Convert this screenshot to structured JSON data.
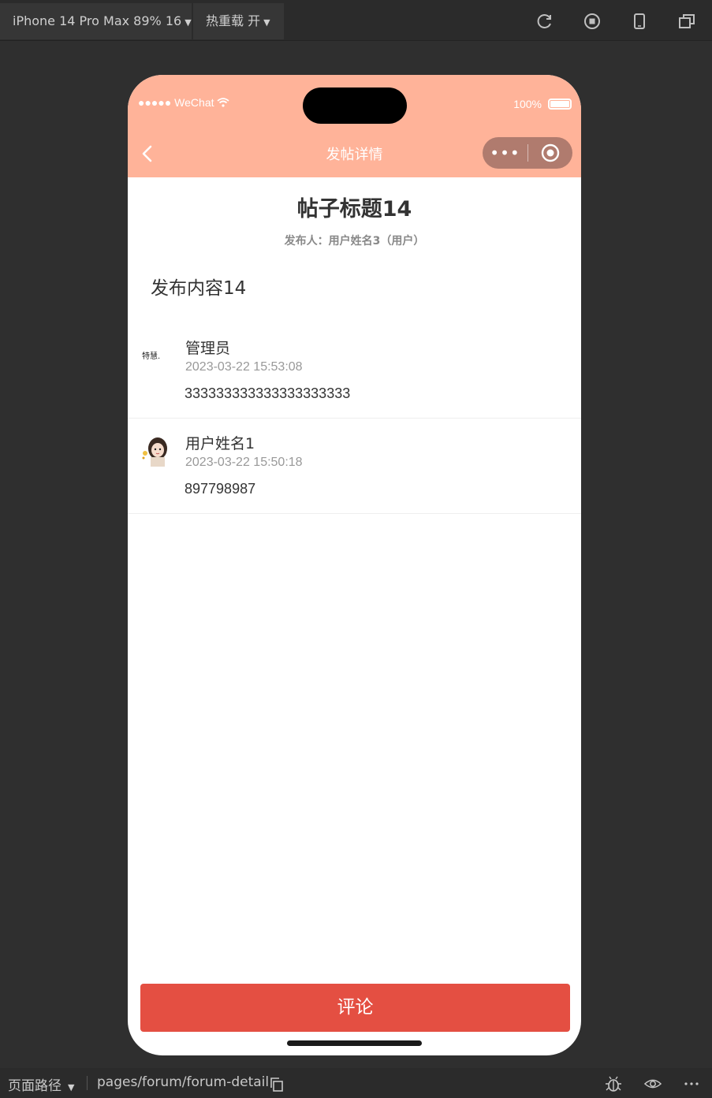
{
  "toolbar": {
    "device_label": "iPhone 14 Pro Max 89% 16",
    "hot_reload_label": "热重载 开"
  },
  "statusbar": {
    "carrier": "●●●●● WeChat",
    "battery": "100%"
  },
  "navbar": {
    "title": "发帖详情"
  },
  "post": {
    "title": "帖子标题14",
    "author": "发布人：用户姓名3（用户）",
    "content": "发布内容14"
  },
  "comments": [
    {
      "name": "管理员",
      "time": "2023-03-22 15:53:08",
      "text": "333333333333333333333",
      "avatar_text": "特慧."
    },
    {
      "name": "用户姓名1",
      "time": "2023-03-22 15:50:18",
      "text": "897798987"
    }
  ],
  "comment_button": "评论",
  "bottombar": {
    "path_label": "页面路径",
    "path": "pages/forum/forum-detail"
  },
  "colors": {
    "accent": "#ffb399",
    "button": "#e44f42"
  }
}
